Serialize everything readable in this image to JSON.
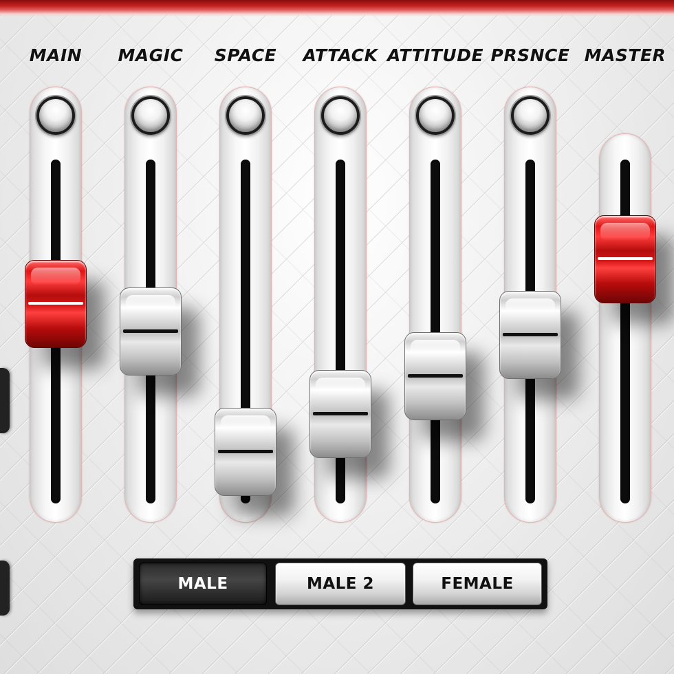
{
  "app": {
    "accent_color": "#c41e1e",
    "panel_color": "#ececec"
  },
  "faders": [
    {
      "label": "MAIN",
      "level": 0.58,
      "knob_color": "red",
      "has_led": true
    },
    {
      "label": "MAGIC",
      "level": 0.5,
      "knob_color": "silver",
      "has_led": true
    },
    {
      "label": "SPACE",
      "level": 0.15,
      "knob_color": "silver",
      "has_led": true
    },
    {
      "label": "ATTACK",
      "level": 0.26,
      "knob_color": "silver",
      "has_led": true
    },
    {
      "label": "ATTITUDE",
      "level": 0.37,
      "knob_color": "silver",
      "has_led": true
    },
    {
      "label": "PRSNCE",
      "level": 0.49,
      "knob_color": "silver",
      "has_led": true
    },
    {
      "label": "MASTER",
      "level": 0.71,
      "knob_color": "red",
      "has_led": false
    }
  ],
  "voice_buttons": [
    {
      "label": "MALE",
      "selected": true
    },
    {
      "label": "MALE 2",
      "selected": false
    },
    {
      "label": "FEMALE",
      "selected": false
    }
  ]
}
